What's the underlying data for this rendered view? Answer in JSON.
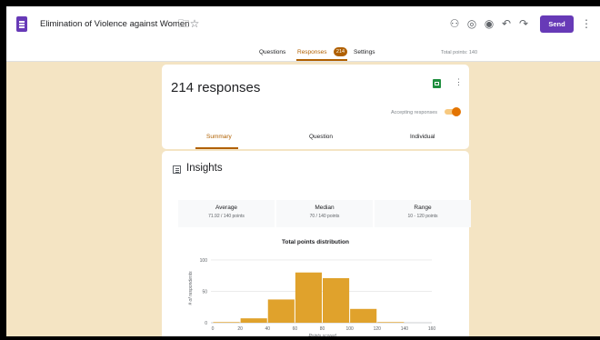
{
  "header": {
    "title": "Elimination of Violence against Women",
    "send_label": "Send",
    "icons": [
      "folder-icon",
      "star-icon",
      "customize-theme-icon",
      "palette-icon",
      "preview-icon",
      "undo-icon",
      "redo-icon",
      "more-vert-icon"
    ]
  },
  "tabs": {
    "questions": "Questions",
    "responses": "Responses",
    "responses_badge": "214",
    "settings": "Settings",
    "total_points": "Total points: 140"
  },
  "responses_card": {
    "count_label": "214 responses",
    "accepting_label": "Accepting responses",
    "accepting": true,
    "subtabs": [
      "Summary",
      "Question",
      "Individual"
    ]
  },
  "insights": {
    "title": "Insights",
    "stats": [
      {
        "label": "Average",
        "value": "71.92 / 140 points"
      },
      {
        "label": "Median",
        "value": "70 / 140 points"
      },
      {
        "label": "Range",
        "value": "10 - 120 points"
      }
    ]
  },
  "colors": {
    "accent": "#673ab7",
    "brand_orange": "#b06000",
    "bar": "#e0a22c",
    "background": "#f4e4c3"
  },
  "chart_data": {
    "type": "bar",
    "title": "Total points distribution",
    "xlabel": "Points scored",
    "ylabel": "# of respondents",
    "x_ticks": [
      0,
      20,
      40,
      60,
      80,
      100,
      120,
      140,
      160
    ],
    "y_ticks": [
      0,
      50,
      100
    ],
    "ylim": [
      0,
      110
    ],
    "bin_width": 20,
    "bins": [
      {
        "start": 0,
        "value": 1
      },
      {
        "start": 20,
        "value": 7
      },
      {
        "start": 40,
        "value": 37
      },
      {
        "start": 60,
        "value": 80
      },
      {
        "start": 80,
        "value": 71
      },
      {
        "start": 100,
        "value": 22
      },
      {
        "start": 120,
        "value": 1
      }
    ],
    "grid": true
  }
}
